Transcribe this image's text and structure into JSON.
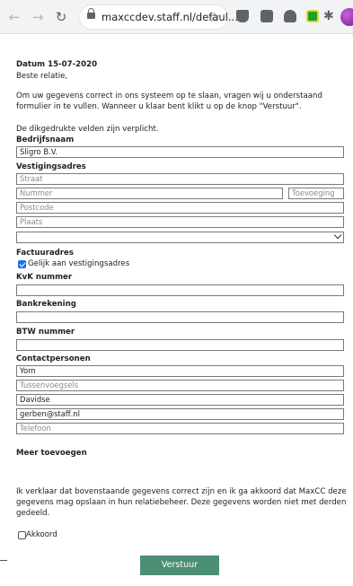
{
  "browser": {
    "url": "maxccdev.staff.nl/defaul..."
  },
  "page": {
    "date_line": "Datum 15-07-2020",
    "greeting": "Beste relatie,",
    "intro_line1": "Om uw gegevens correct in ons systeem op te slaan, vragen wij u onderstaand",
    "intro_line2": "formulier in te vullen. Wanneer u klaar bent klikt u op de knop \"Verstuur\".",
    "required_note": "De dikgedrukte velden zijn verplicht.",
    "company": {
      "label": "Bedrijfsnaam",
      "value": "Sligro B.V."
    },
    "location": {
      "label": "Vestigingsadres",
      "street_placeholder": "Straat",
      "number_placeholder": "Nummer",
      "addition_placeholder": "Toevoeging",
      "postcode_placeholder": "Postcode",
      "city_placeholder": "Plaats",
      "country_value": ""
    },
    "invoice": {
      "label": "Factuuradres",
      "same_as_location_label": "Gelijk aan vestigingsadres",
      "same_as_location_checked": true
    },
    "kvk": {
      "label": "KvK nummer",
      "value": ""
    },
    "bank": {
      "label": "Bankrekening",
      "value": ""
    },
    "vat": {
      "label": "BTW nummer",
      "value": ""
    },
    "contacts": {
      "label": "Contactpersonen",
      "first_name": "Yorn",
      "infix_placeholder": "Tussenvoegsels",
      "last_name": "Davidse",
      "email": "gerben@staff.nl",
      "phone_placeholder": "Telefoon"
    },
    "add_more": "Meer toevoegen",
    "consent_line1": "Ik verklaar dat bovenstaande gegevens correct zijn en ik ga akkoord dat MaxCC deze",
    "consent_line2": "gegevens mag opslaan in hun relatiebeheer. Deze gegevens worden niet met derden",
    "consent_line3": "gedeeld.",
    "agree_label": "Akkoord",
    "agree_checked": false,
    "submit_label": "Verstuur"
  },
  "colors": {
    "submit_bg": "#4d8f72",
    "checkbox_on": "#1a73e8",
    "toolbar_bg": "#f1f3f4"
  }
}
